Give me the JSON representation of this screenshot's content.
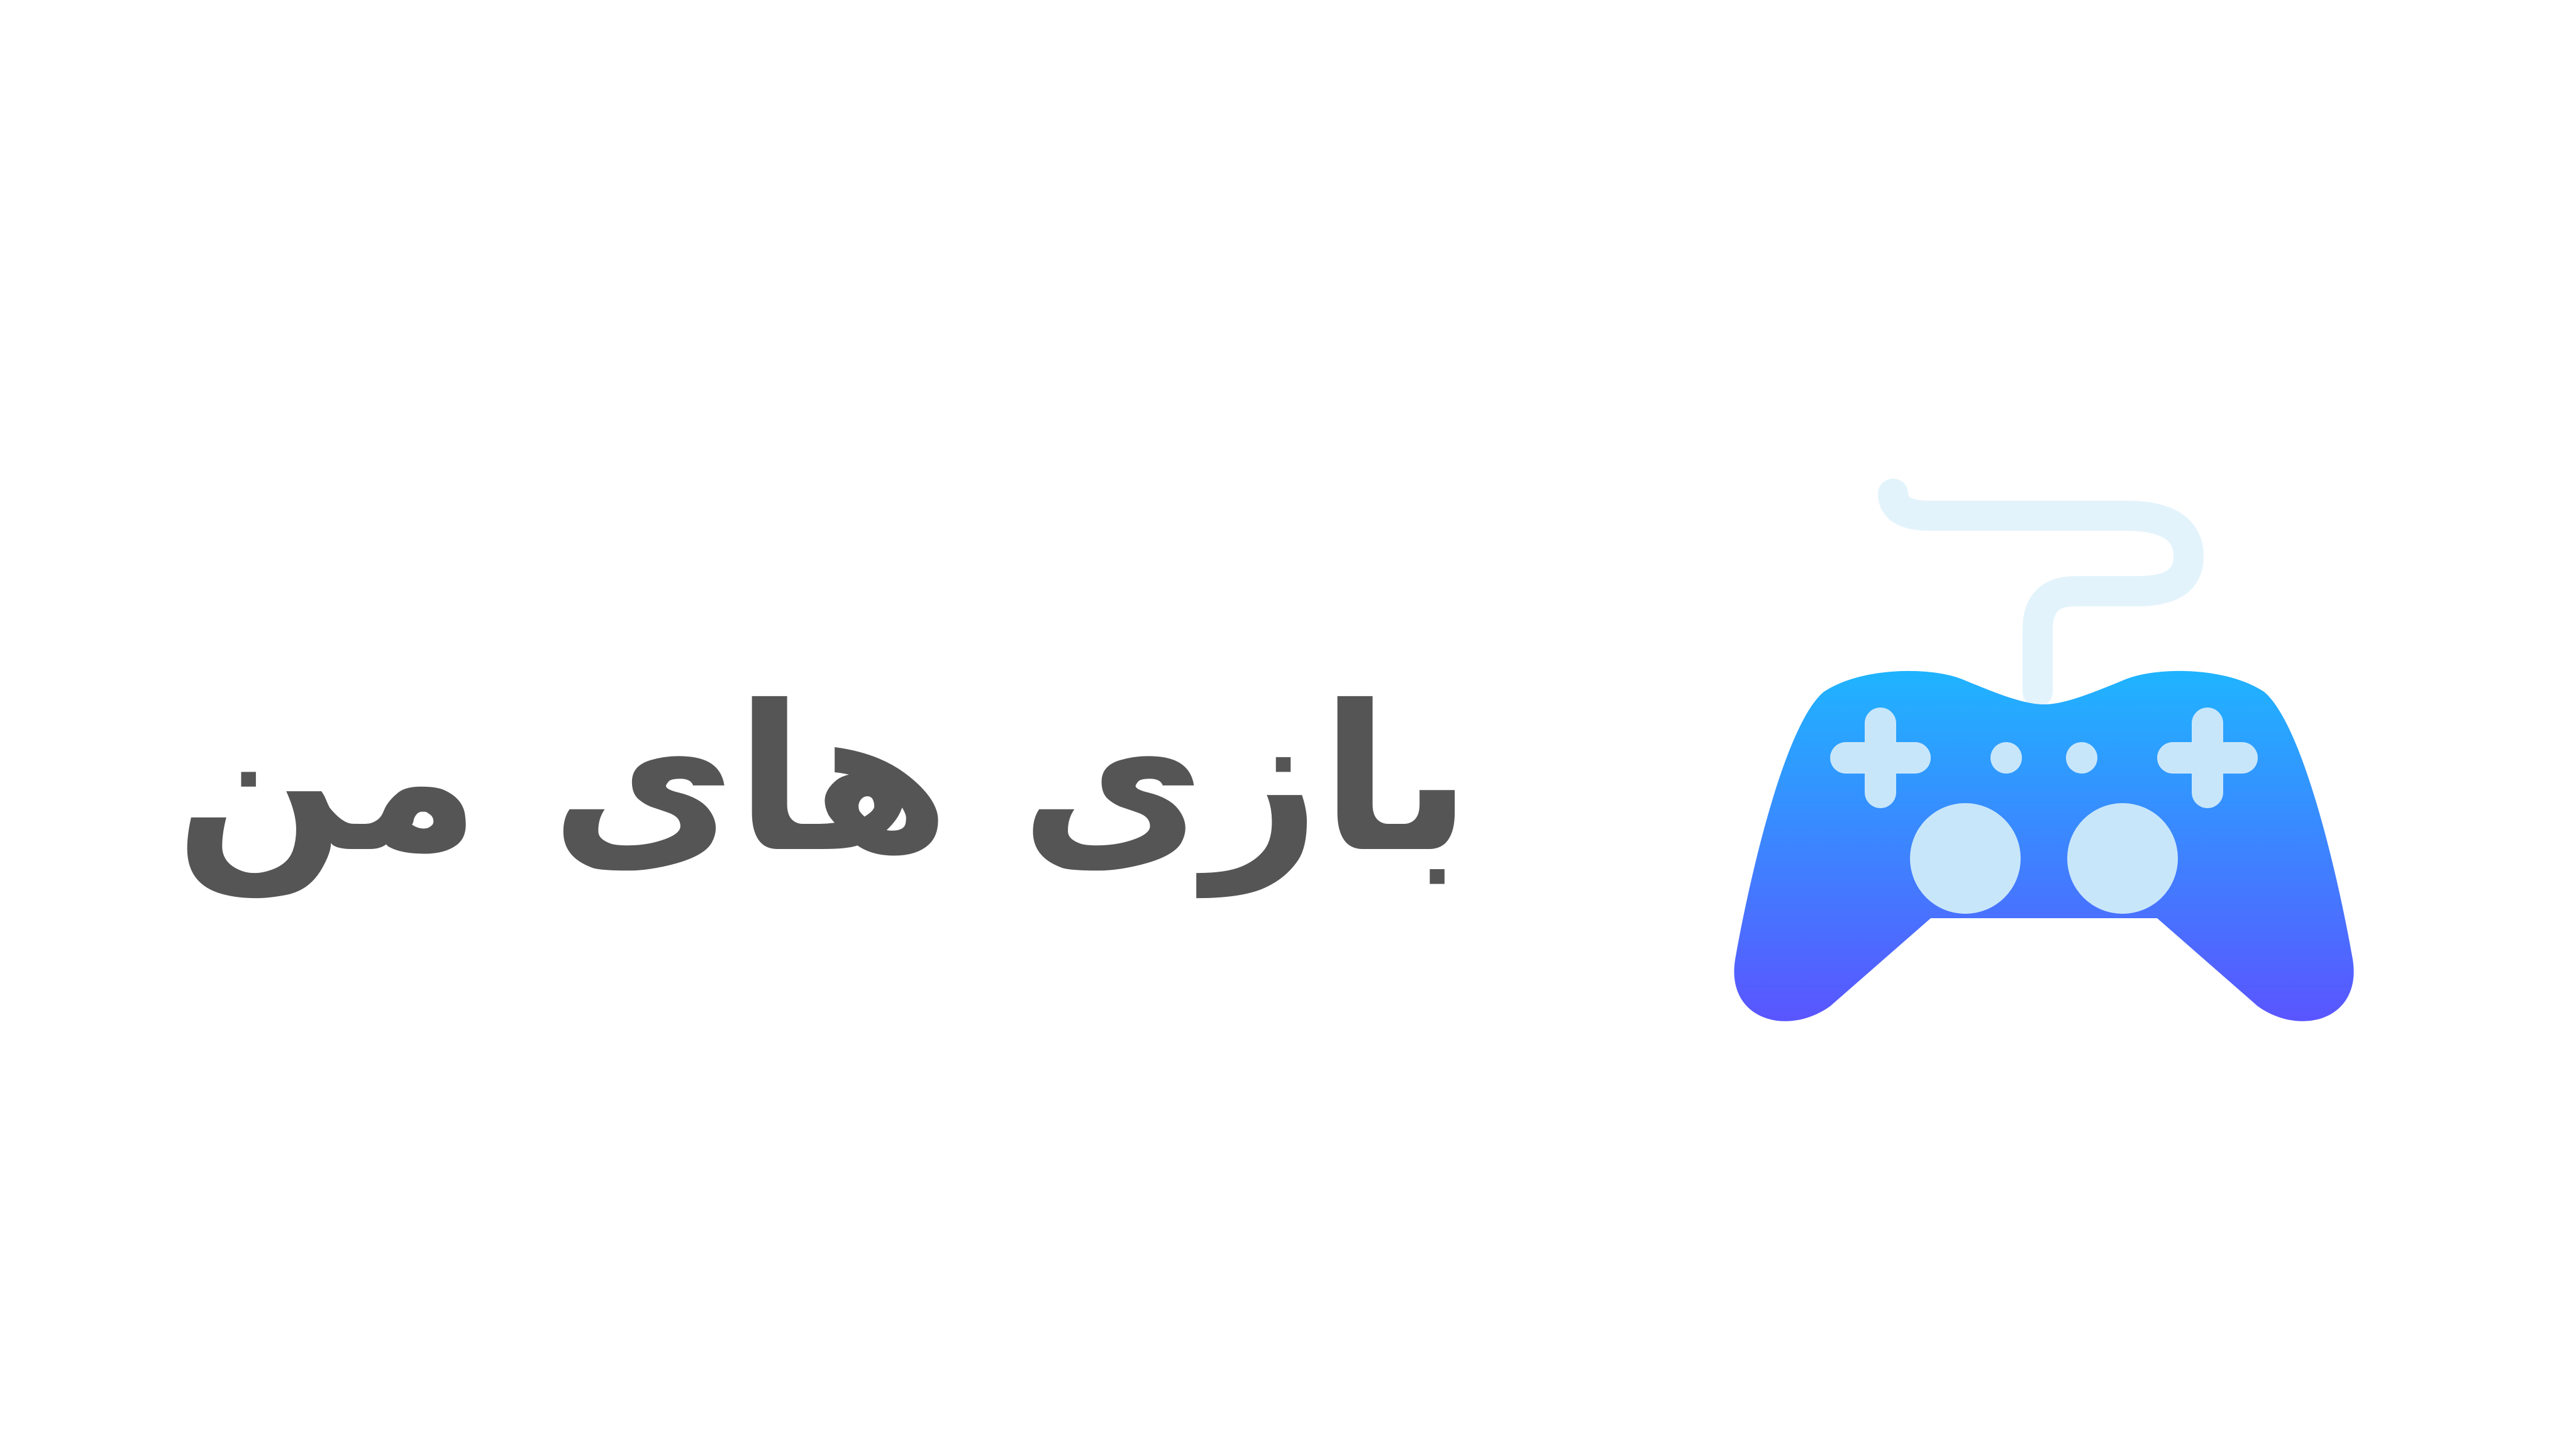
{
  "title": "بازی های من",
  "icon": "gamepad-icon",
  "colors": {
    "background": "#ffffff",
    "text": "#555555",
    "controller_top": "#1fb4ff",
    "controller_bottom": "#5a55ff",
    "cable": "#e3f3fc",
    "buttons": "#c8e6fa"
  }
}
